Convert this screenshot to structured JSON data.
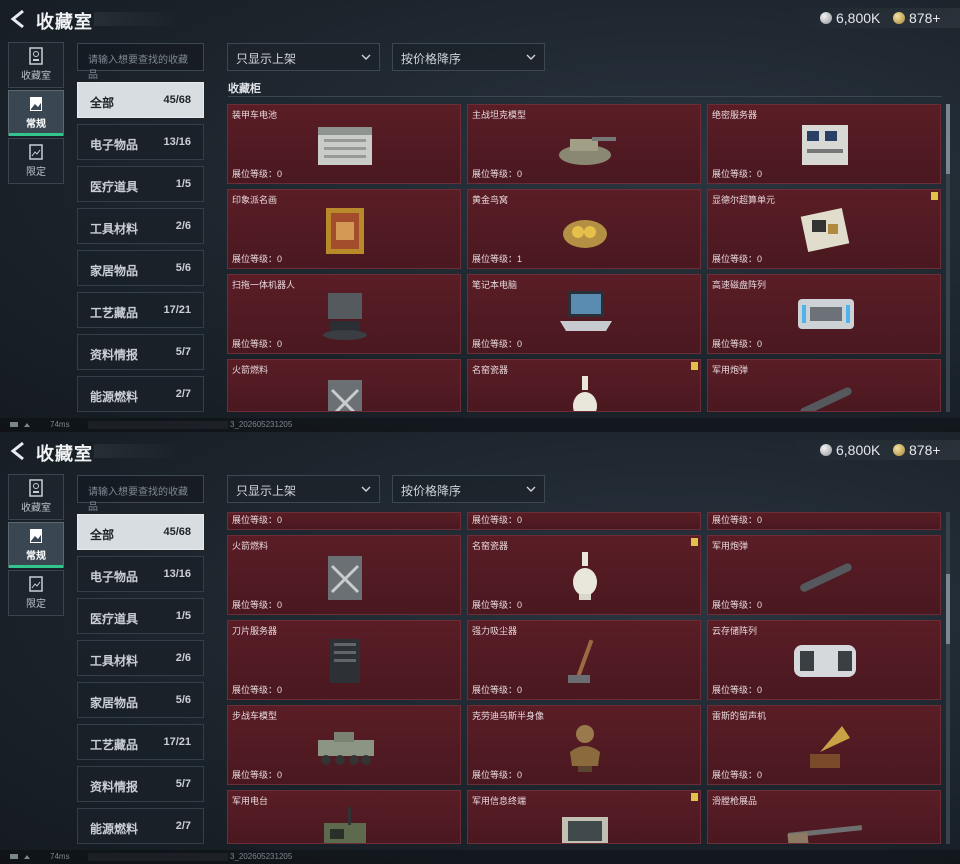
{
  "title": "收藏室",
  "currency": {
    "silver": "6,800K",
    "gold": "878+"
  },
  "rail": [
    {
      "label": "收藏室",
      "icon": "vault-icon"
    },
    {
      "label": "常规",
      "icon": "picture-icon"
    },
    {
      "label": "限定",
      "icon": "gallery-icon"
    }
  ],
  "search": {
    "placeholder": "请输入想要查找的收藏品"
  },
  "filters": {
    "shelf": "只显示上架",
    "sort": "按价格降序"
  },
  "section_title": "收藏柜",
  "categories": [
    {
      "name": "全部",
      "count": "45/68"
    },
    {
      "name": "电子物品",
      "count": "13/16"
    },
    {
      "name": "医疗道具",
      "count": "1/5"
    },
    {
      "name": "工具材料",
      "count": "2/6"
    },
    {
      "name": "家居物品",
      "count": "5/6"
    },
    {
      "name": "工艺藏品",
      "count": "17/21"
    },
    {
      "name": "资料情报",
      "count": "5/7"
    },
    {
      "name": "能源燃料",
      "count": "2/7"
    }
  ],
  "level_label": "展位等级：",
  "top_items": [
    {
      "name": "装甲车电池",
      "level": "0",
      "art": "battery"
    },
    {
      "name": "主战坦克模型",
      "level": "0",
      "art": "tank"
    },
    {
      "name": "绝密服务器",
      "level": "0",
      "art": "server"
    },
    {
      "name": "印象派名画",
      "level": "0",
      "art": "painting"
    },
    {
      "name": "黄金鸟窝",
      "level": "1",
      "art": "nest"
    },
    {
      "name": "显德尔超算单元",
      "level": "0",
      "art": "chip",
      "badge": true
    },
    {
      "name": "扫拖一体机器人",
      "level": "0",
      "art": "robot"
    },
    {
      "name": "笔记本电脑",
      "level": "0",
      "art": "laptop"
    },
    {
      "name": "高速磁盘阵列",
      "level": "0",
      "art": "disk"
    },
    {
      "name": "火箭燃料",
      "level": "",
      "art": "fuel"
    },
    {
      "name": "名窑瓷器",
      "level": "",
      "art": "vase",
      "badge": true
    },
    {
      "name": "军用炮弹",
      "level": "",
      "art": "shell"
    }
  ],
  "bottom_items": [
    {
      "name": "火箭燃料",
      "level": "0",
      "art": "fuel"
    },
    {
      "name": "名窑瓷器",
      "level": "0",
      "art": "vase",
      "badge": true
    },
    {
      "name": "军用炮弹",
      "level": "0",
      "art": "shell"
    },
    {
      "name": "刀片服务器",
      "level": "0",
      "art": "blade"
    },
    {
      "name": "强力吸尘器",
      "level": "0",
      "art": "vacuum"
    },
    {
      "name": "云存储阵列",
      "level": "0",
      "art": "cloud"
    },
    {
      "name": "步战车模型",
      "level": "0",
      "art": "ifv"
    },
    {
      "name": "克劳迪乌斯半身像",
      "level": "0",
      "art": "bust"
    },
    {
      "name": "雷斯的留声机",
      "level": "0",
      "art": "phono"
    },
    {
      "name": "军用电台",
      "level": "",
      "art": "radio"
    },
    {
      "name": "军用信息终端",
      "level": "",
      "art": "terminal",
      "badge": true
    },
    {
      "name": "滑膛枪展品",
      "level": "",
      "art": "musket"
    }
  ],
  "status": {
    "ping": "74ms",
    "build": "3_202605231205"
  }
}
